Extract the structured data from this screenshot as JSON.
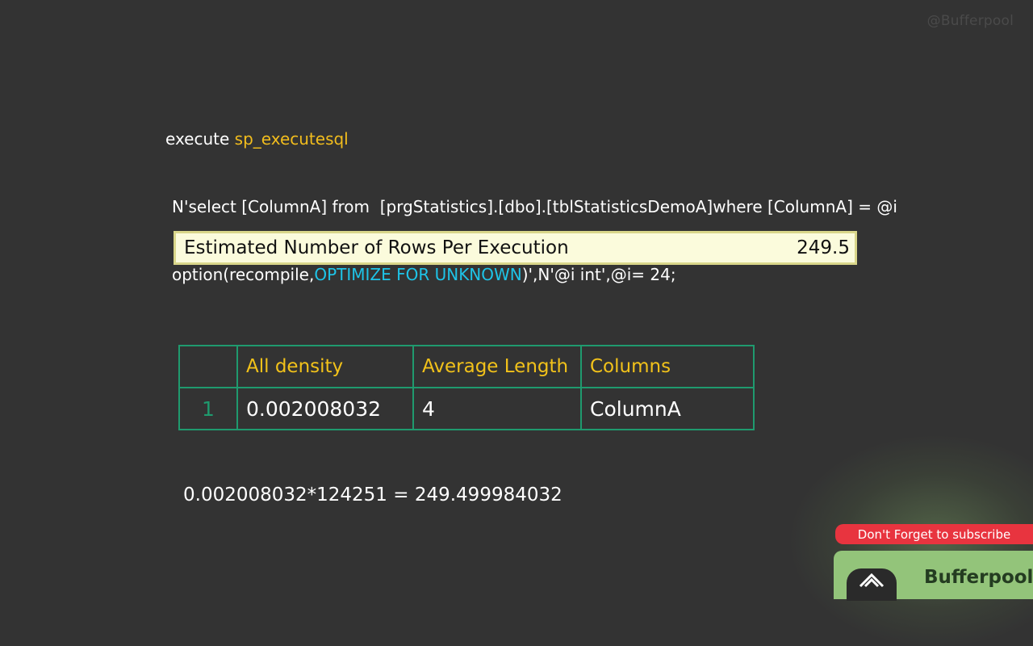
{
  "watermark": "@Bufferpool",
  "code": {
    "line1_prefix": "execute ",
    "line1_proc": "sp_executesql",
    "line2": "N'select [ColumnA] from  [prgStatistics].[dbo].[tblStatisticsDemoA]where [ColumnA] = @i",
    "line3_prefix": "option(recompile,",
    "line3_hint": "OPTIMIZE FOR UNKNOWN",
    "line3_suffix": ")',N'@i int',@i= 24;"
  },
  "estimate": {
    "label": "Estimated Number of Rows Per Execution",
    "value": "249.5"
  },
  "density_table": {
    "headers": [
      "",
      "All density",
      "Average Length",
      "Columns"
    ],
    "rows": [
      [
        "1",
        "0.002008032",
        "4",
        "ColumnA"
      ]
    ]
  },
  "formula": "0.002008032*124251 = 249.499984032",
  "promo": {
    "subscribe": "Don't Forget to subscribe",
    "channel": "Bufferpool",
    "logo_icon": "bufferpool-logo-icon"
  },
  "colors": {
    "background": "#333333",
    "keyword_yellow": "#f2bd1d",
    "keyword_cyan": "#1ec4e8",
    "table_border": "#1f9a6e",
    "header_text": "#f2c21a",
    "estimate_bg": "#fbfbdc",
    "subscribe_red": "#e8343f"
  }
}
